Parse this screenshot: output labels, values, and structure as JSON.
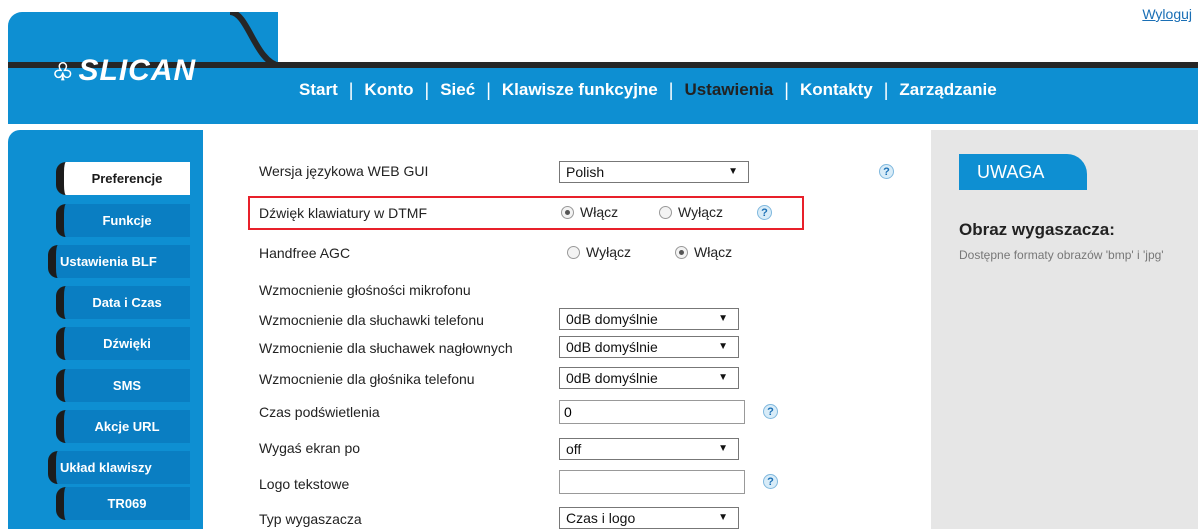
{
  "header": {
    "logout_label": "Wyloguj",
    "logo_text": "SLICAN",
    "brand_color": "#0e8fd2",
    "nav": [
      {
        "label": "Start"
      },
      {
        "label": "Konto"
      },
      {
        "label": "Sieć"
      },
      {
        "label": "Klawisze funkcyjne"
      },
      {
        "label": "Ustawienia",
        "active": true
      },
      {
        "label": "Kontakty"
      },
      {
        "label": "Zarządzanie"
      }
    ]
  },
  "sidebar": {
    "items": [
      {
        "label": "Preferencje",
        "active": true
      },
      {
        "label": "Funkcje"
      },
      {
        "label": "Ustawienia BLF"
      },
      {
        "label": "Data i Czas"
      },
      {
        "label": "Dźwięki"
      },
      {
        "label": "SMS"
      },
      {
        "label": "Akcje URL"
      },
      {
        "label": "Układ klawiszy"
      },
      {
        "label": "TR069"
      }
    ]
  },
  "form": {
    "language": {
      "label": "Wersja językowa WEB GUI",
      "value": "Polish"
    },
    "dtmf": {
      "label": "Dźwięk klawiatury w DTMF",
      "opt1": "Włącz",
      "opt2": "Wyłącz",
      "selected": "Włącz"
    },
    "agc": {
      "label": "Handfree AGC",
      "opt1": "Wyłącz",
      "opt2": "Włącz",
      "selected": "Włącz"
    },
    "mic_gain_heading": "Wzmocnienie głośności mikrofonu",
    "handset_gain": {
      "label": "Wzmocnienie dla słuchawki telefonu",
      "value": "0dB domyślnie"
    },
    "headset_gain": {
      "label": "Wzmocnienie dla słuchawek nagłownych",
      "value": "0dB domyślnie"
    },
    "speaker_gain": {
      "label": "Wzmocnienie dla głośnika telefonu",
      "value": "0dB domyślnie"
    },
    "backlight": {
      "label": "Czas podświetlenia",
      "value": "0"
    },
    "screen_off": {
      "label": "Wygaś ekran po",
      "value": "off"
    },
    "logo_text": {
      "label": "Logo tekstowe",
      "value": ""
    },
    "screensaver_type": {
      "label": "Typ wygaszacza",
      "value": "Czas i logo"
    },
    "help_glyph": "?"
  },
  "notice": {
    "tab_label": "UWAGA",
    "title": "Obraz wygaszacza:",
    "text": "Dostępne formaty obrazów 'bmp' i 'jpg'"
  }
}
